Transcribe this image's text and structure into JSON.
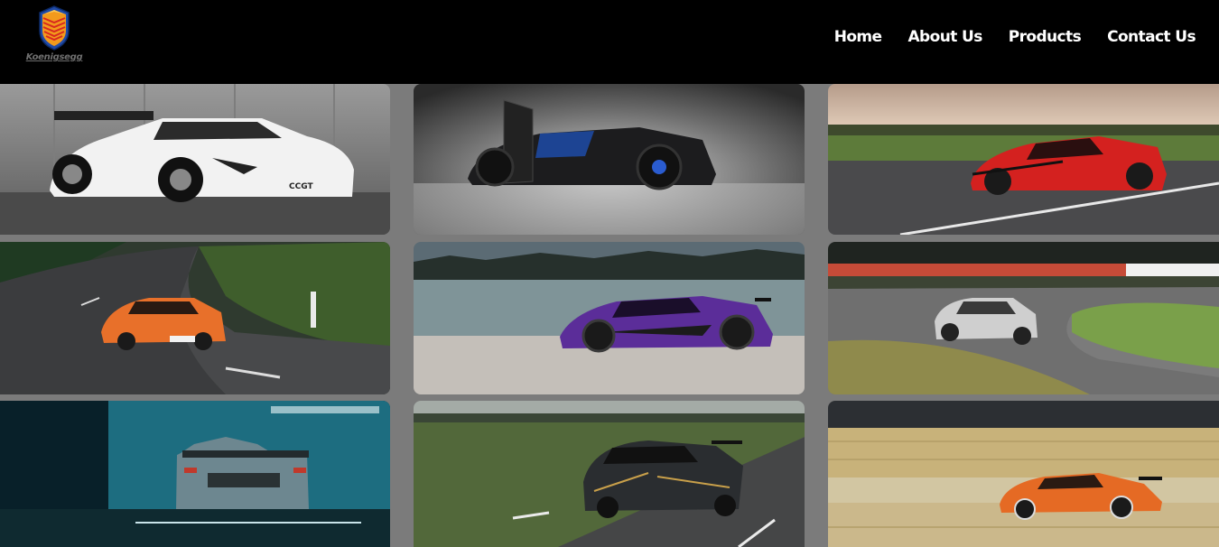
{
  "brand": {
    "name": "Koenigsegg",
    "logo_icon": "koenigsegg-shield-icon",
    "colors": {
      "shield_orange": "#f29a1c",
      "shield_red": "#d8281f",
      "shield_blue": "#1f4aa8"
    }
  },
  "nav": {
    "items": [
      {
        "label": "Home"
      },
      {
        "label": "About Us"
      },
      {
        "label": "Products"
      },
      {
        "label": "Contact Us"
      }
    ]
  },
  "gallery": {
    "background": "#7b7b7b",
    "photos": [
      {
        "subject": "white-ccgt-car-photo",
        "car_color": "#f2f2f2",
        "scene": "grayscale-garage",
        "badge": "CCGT"
      },
      {
        "subject": "black-jesko-studio-photo",
        "car_color": "#1c1c1e",
        "scene": "studio"
      },
      {
        "subject": "red-agera-track-photo",
        "car_color": "#d4211f",
        "scene": "airfield-dusk"
      },
      {
        "subject": "orange-ccr-road-photo",
        "car_color": "#e8702a",
        "scene": "mountain-road"
      },
      {
        "subject": "purple-agera-lake-photo",
        "car_color": "#5b2d99",
        "scene": "lakeside"
      },
      {
        "subject": "silver-cc-racetrack-photo",
        "car_color": "#cfcfcf",
        "scene": "racetrack"
      },
      {
        "subject": "teal-regera-garage-photo",
        "car_color": "#8aa3ad",
        "scene": "teal-garage"
      },
      {
        "subject": "black-gold-agera-road-photo",
        "car_color": "#2a2d30",
        "scene": "country-road"
      },
      {
        "subject": "orange-ccx-motion-photo",
        "car_color": "#e56a24",
        "scene": "motion-blur-field"
      }
    ]
  }
}
